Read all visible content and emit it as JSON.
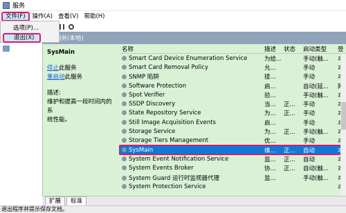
{
  "window": {
    "title": "服务"
  },
  "menu": [
    {
      "label": "文件(F)"
    },
    {
      "label": "操作(A)"
    },
    {
      "label": "查看(V)"
    },
    {
      "label": "帮助(H)"
    }
  ],
  "file_menu": {
    "items": [
      {
        "label": "选项(P)..."
      },
      {
        "label": "退出(X)"
      }
    ]
  },
  "header": {
    "title": "服务(本地)"
  },
  "details": {
    "service_name": "SysMain",
    "stop_link": "停止",
    "stop_suffix": "此服务",
    "restart_link": "重启动",
    "restart_suffix": "此服务",
    "desc_label": "描述:",
    "desc_line1": "维护和提高一段时间内的系",
    "desc_line2": "统性能。"
  },
  "columns": {
    "name": "名称",
    "desc": "描述",
    "status": "状态",
    "startup": "启动类型",
    "login": "登"
  },
  "rows": [
    {
      "name": "Smart Card Device Enumeration Service",
      "desc": "为给...",
      "status": "",
      "startup": "手动(触...",
      "login": "本"
    },
    {
      "name": "Smart Card Removal Policy",
      "desc": "允...",
      "status": "",
      "startup": "手动",
      "login": "本"
    },
    {
      "name": "SNMP 陷阱",
      "desc": "接...",
      "status": "",
      "startup": "手动",
      "login": "本"
    },
    {
      "name": "Software Protection",
      "desc": "启...",
      "status": "",
      "startup": "自动(延...",
      "login": "网"
    },
    {
      "name": "Spot Verifier",
      "desc": "验...",
      "status": "",
      "startup": "手动(触...",
      "login": "本"
    },
    {
      "name": "SSDP Discovery",
      "desc": "当...",
      "status": "正...",
      "startup": "手动",
      "login": "本"
    },
    {
      "name": "State Repository Service",
      "desc": "为...",
      "status": "正...",
      "startup": "手动",
      "login": "本"
    },
    {
      "name": "Still Image Acquisition Events",
      "desc": "启...",
      "status": "",
      "startup": "手动",
      "login": "本"
    },
    {
      "name": "Storage Service",
      "desc": "为...",
      "status": "正...",
      "startup": "手动(触...",
      "login": "本"
    },
    {
      "name": "Storage Tiers Management",
      "desc": "优...",
      "status": "",
      "startup": "手动",
      "login": "本"
    },
    {
      "name": "SysMain",
      "desc": "维...",
      "status": "正...",
      "startup": "自动",
      "login": "本",
      "selected": true
    },
    {
      "name": "System Event Notification Service",
      "desc": "监...",
      "status": "正...",
      "startup": "自动",
      "login": "本"
    },
    {
      "name": "System Events Broker",
      "desc": "协...",
      "status": "正...",
      "startup": "自动(触...",
      "login": "本"
    },
    {
      "name": "System Guard 运行时监视器代理",
      "desc": "监...",
      "status": "",
      "startup": "手动(触...",
      "login": "本"
    },
    {
      "name": "System Protection Service",
      "desc": "",
      "status": "",
      "startup": "",
      "login": "本"
    }
  ],
  "tabs": [
    {
      "label": "扩展"
    },
    {
      "label": "标准"
    }
  ],
  "status_bar": {
    "text": "退出程序并提示保存文档。"
  }
}
